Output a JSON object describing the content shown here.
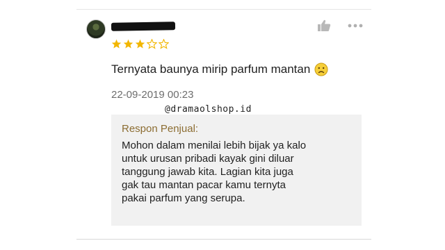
{
  "review": {
    "username": "",
    "rating": 3,
    "max_rating": 5,
    "text": "Ternyata baunya mirip parfum mantan",
    "emoji_icon": "sad-face-icon",
    "date": "22-09-2019 00:23",
    "like_icon": "thumbs-up-icon",
    "more_icon": "more-options-icon"
  },
  "watermark": "@dramaolshop.id",
  "seller_response": {
    "title": "Respon Penjual:",
    "lines": [
      "Mohon dalam menilai lebih bijak ya kalo",
      "untuk urusan pribadi kayak gini diluar",
      "tanggung jawab kita. Lagian kita juga",
      "gak tau mantan pacar kamu ternyta",
      "pakai parfum yang serupa."
    ]
  },
  "colors": {
    "star_filled": "#f2b600",
    "star_empty": "#f2b600",
    "response_title": "#8c6d32",
    "response_bg": "#f1f1f1",
    "date_text": "#6d6d6d"
  }
}
